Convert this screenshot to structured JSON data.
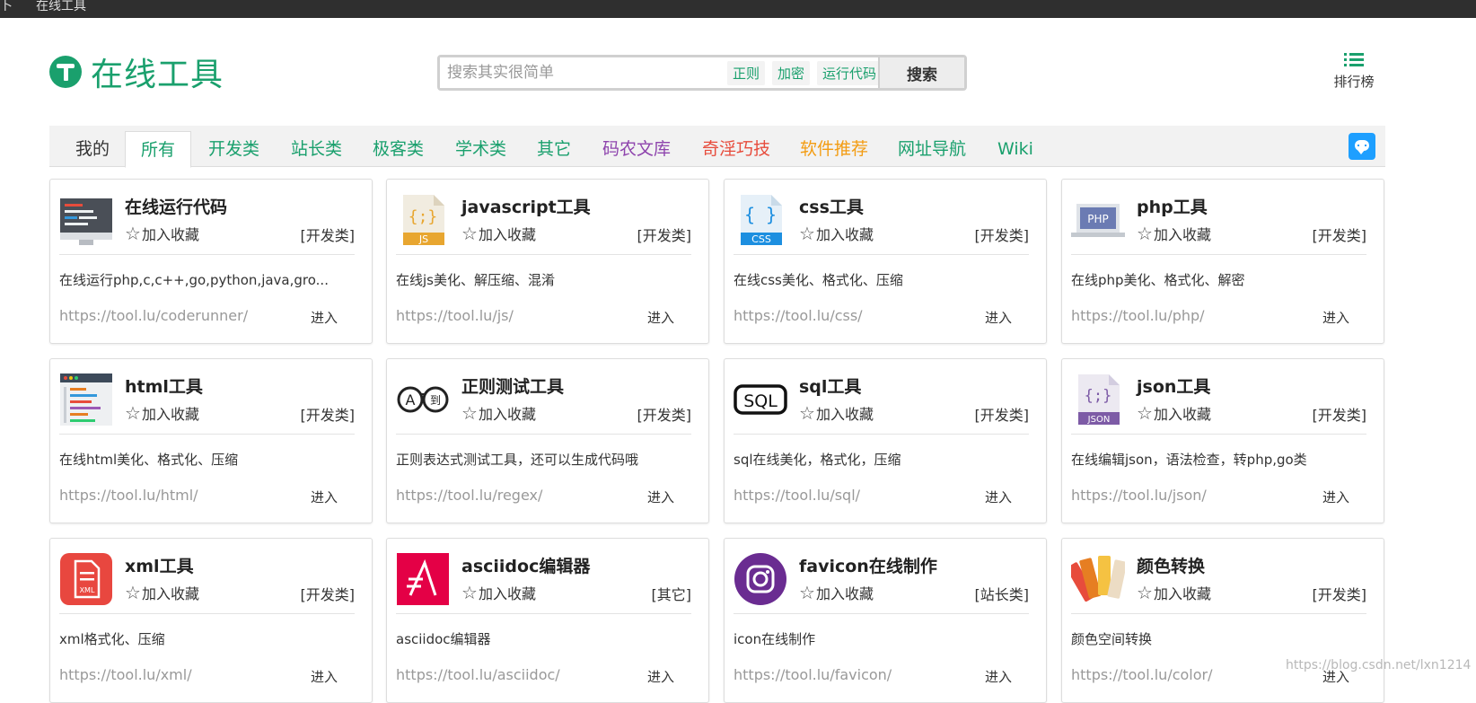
{
  "topbar": {
    "left_char": "卜",
    "title": "在线工具"
  },
  "header": {
    "logo_text": "在线工具"
  },
  "search": {
    "placeholder": "搜索其实很简单",
    "quick_tags": [
      "正则",
      "加密",
      "运行代码"
    ],
    "button_label": "搜索"
  },
  "rank": {
    "label": "排行榜"
  },
  "tabs": [
    {
      "label": "我的",
      "color": "#333333"
    },
    {
      "label": "所有",
      "color": "#1aa06d",
      "active": true
    },
    {
      "label": "开发类",
      "color": "#1aa06d"
    },
    {
      "label": "站长类",
      "color": "#1aa06d"
    },
    {
      "label": "极客类",
      "color": "#1aa06d"
    },
    {
      "label": "学术类",
      "color": "#1aa06d"
    },
    {
      "label": "其它",
      "color": "#1aa06d"
    },
    {
      "label": "码农文库",
      "color": "#8e44ad"
    },
    {
      "label": "奇淫巧技",
      "color": "#e74c3c"
    },
    {
      "label": "软件推荐",
      "color": "#f39c12"
    },
    {
      "label": "网址导航",
      "color": "#1aa06d"
    },
    {
      "label": "Wiki",
      "color": "#1aa06d"
    }
  ],
  "fav_label": "加入收藏",
  "enter_label": "进入",
  "cards": [
    {
      "title": "在线运行代码",
      "category": "[开发类]",
      "desc": "在线运行php,c,c++,go,python,java,gro...",
      "url": "https://tool.lu/coderunner/",
      "icon": "monitor-code-icon"
    },
    {
      "title": "javascript工具",
      "category": "[开发类]",
      "desc": "在线js美化、解压缩、混淆",
      "url": "https://tool.lu/js/",
      "icon": "js-file-icon"
    },
    {
      "title": "css工具",
      "category": "[开发类]",
      "desc": "在线css美化、格式化、压缩",
      "url": "https://tool.lu/css/",
      "icon": "css-file-icon"
    },
    {
      "title": "php工具",
      "category": "[开发类]",
      "desc": "在线php美化、格式化、解密",
      "url": "https://tool.lu/php/",
      "icon": "php-laptop-icon"
    },
    {
      "title": "html工具",
      "category": "[开发类]",
      "desc": "在线html美化、格式化、压缩",
      "url": "https://tool.lu/html/",
      "icon": "html-editor-icon"
    },
    {
      "title": "正则测试工具",
      "category": "[开发类]",
      "desc": "正则表达式测试工具，还可以生成代码哦",
      "url": "https://tool.lu/regex/",
      "icon": "regex-a-to-icon"
    },
    {
      "title": "sql工具",
      "category": "[开发类]",
      "desc": "sql在线美化，格式化，压缩",
      "url": "https://tool.lu/sql/",
      "icon": "sql-icon"
    },
    {
      "title": "json工具",
      "category": "[开发类]",
      "desc": "在线编辑json，语法检查，转php,go类",
      "url": "https://tool.lu/json/",
      "icon": "json-file-icon"
    },
    {
      "title": "xml工具",
      "category": "[开发类]",
      "desc": "xml格式化、压缩",
      "url": "https://tool.lu/xml/",
      "icon": "xml-file-icon"
    },
    {
      "title": "asciidoc编辑器",
      "category": "[其它]",
      "desc": "asciidoc编辑器",
      "url": "https://tool.lu/asciidoc/",
      "icon": "asciidoc-icon"
    },
    {
      "title": "favicon在线制作",
      "category": "[站长类]",
      "desc": "icon在线制作",
      "url": "https://tool.lu/favicon/",
      "icon": "camera-instagram-icon"
    },
    {
      "title": "颜色转换",
      "category": "[开发类]",
      "desc": "颜色空间转换",
      "url": "https://tool.lu/color/",
      "icon": "color-swatch-icon"
    }
  ],
  "watermark": "https://blog.csdn.net/lxn1214"
}
